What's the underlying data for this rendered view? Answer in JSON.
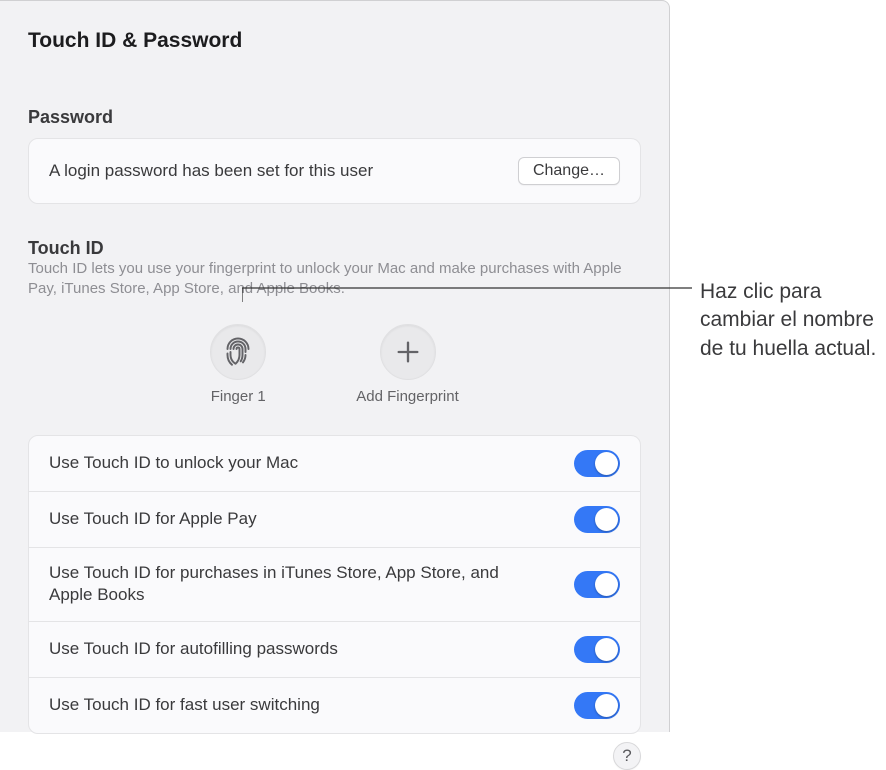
{
  "window_title": "Touch ID & Password",
  "password": {
    "heading": "Password",
    "status": "A login password has been set for this user",
    "change_label": "Change…"
  },
  "touchid": {
    "heading": "Touch ID",
    "description": "Touch ID lets you use your fingerprint to unlock your Mac and make purchases with Apple Pay, iTunes Store, App Store, and Apple Books.",
    "fingerprints": [
      {
        "label": "Finger 1",
        "name": "finger-1",
        "icon": "fingerprint"
      },
      {
        "label": "Add Fingerprint",
        "name": "add-fingerprint",
        "icon": "plus"
      }
    ]
  },
  "options": [
    {
      "label": "Use Touch ID to unlock your Mac",
      "enabled": true
    },
    {
      "label": "Use Touch ID for Apple Pay",
      "enabled": true
    },
    {
      "label": "Use Touch ID for purchases in iTunes Store, App Store, and Apple Books",
      "enabled": true
    },
    {
      "label": "Use Touch ID for autofilling passwords",
      "enabled": true
    },
    {
      "label": "Use Touch ID for fast user switching",
      "enabled": true
    }
  ],
  "help_label": "?",
  "callout": "Haz clic para cambiar el nombre de tu huella actual."
}
